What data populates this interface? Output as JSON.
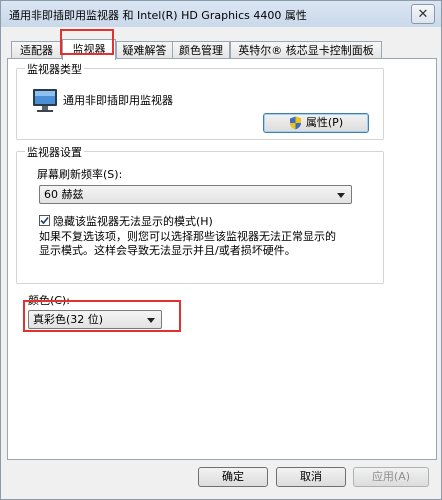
{
  "window": {
    "title": "通用非即插即用监视器 和 Intel(R) HD Graphics 4400 属性",
    "close_icon": "close-icon"
  },
  "tabs": [
    {
      "label": "适配器",
      "active": false
    },
    {
      "label": "监视器",
      "active": true
    },
    {
      "label": "疑难解答",
      "active": false
    },
    {
      "label": "颜色管理",
      "active": false
    },
    {
      "label": "英特尔® 核芯显卡控制面板",
      "active": false
    }
  ],
  "monitor_type": {
    "group_label": "监视器类型",
    "monitor_name": "通用非即插即用监视器",
    "properties_button": "属性(P)",
    "monitor_icon": "monitor-icon",
    "shield_icon": "shield-icon"
  },
  "monitor_settings": {
    "group_label": "监视器设置",
    "refresh_label": "屏幕刷新频率(S):",
    "refresh_value": "60 赫兹",
    "hide_modes_label": "隐藏该监视器无法显示的模式(H)",
    "hide_modes_checked": true,
    "description_line1": "如果不复选该项，则您可以选择那些该监视器无法正常显示的",
    "description_line2": "显示模式。这样会导致无法显示并且/或者损坏硬件。"
  },
  "color": {
    "label": "颜色(C):",
    "value": "真彩色(32 位)"
  },
  "footer": {
    "ok": "确定",
    "cancel": "取消",
    "apply": "应用(A)"
  },
  "colors": {
    "highlight": "#e2322d",
    "titlebar": "#c9d8ea"
  }
}
